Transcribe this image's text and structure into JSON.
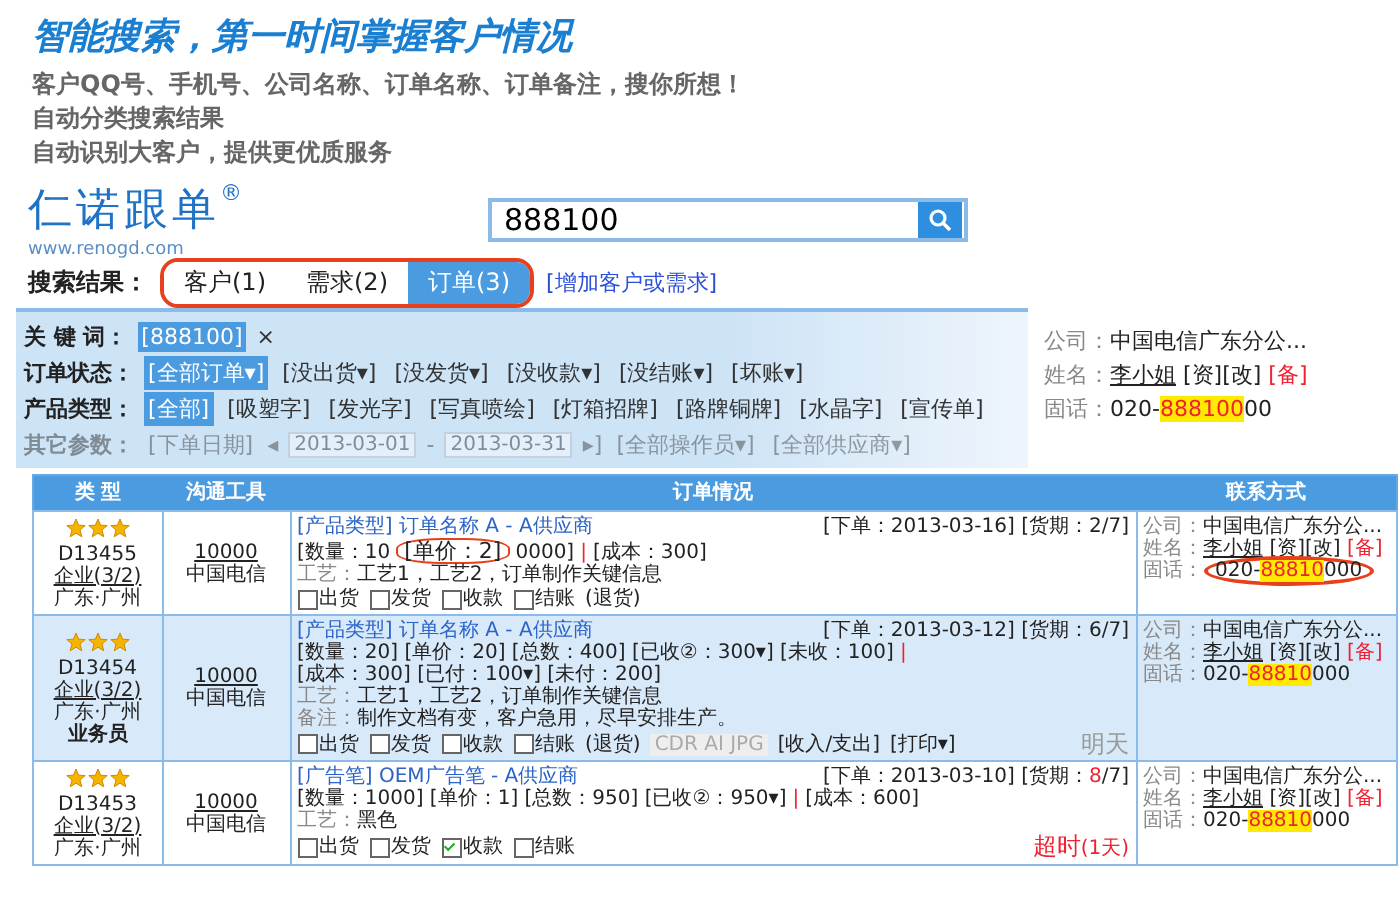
{
  "headline": "智能搜索，第一时间掌握客户情况",
  "features": [
    "客户QQ号、手机号、公司名称、订单名称、订单备注，搜你所想！",
    "自动分类搜索结果",
    "自动识别大客户，提供更优质服务"
  ],
  "app": {
    "logo": "仁诺跟单",
    "logo_mark": "®",
    "logo_url": "www.renogd.com",
    "search": {
      "value": "888100"
    },
    "results_label": "搜索结果：",
    "result_tabs": [
      {
        "label": "客户(1)",
        "selected": false
      },
      {
        "label": "需求(2)",
        "selected": false
      },
      {
        "label": "订单(3)",
        "selected": true
      }
    ],
    "add_link": "[增加客户或需求]",
    "filters": [
      {
        "label": "关 键 词：",
        "faded": false,
        "items": [
          {
            "text": "[888100]",
            "kind": "chip",
            "selected": true
          },
          {
            "text": "×",
            "kind": "close"
          }
        ]
      },
      {
        "label": "订单状态：",
        "faded": false,
        "items": [
          {
            "text": "[全部订单▾]",
            "kind": "chip",
            "selected": true
          },
          {
            "text": "[没出货▾]",
            "kind": "chip",
            "selected": false
          },
          {
            "text": "[没发货▾]",
            "kind": "chip",
            "selected": false
          },
          {
            "text": "[没收款▾]",
            "kind": "chip",
            "selected": false
          },
          {
            "text": "[没结账▾]",
            "kind": "chip",
            "selected": false
          },
          {
            "text": "[坏账▾]",
            "kind": "chip",
            "selected": false
          }
        ]
      },
      {
        "label": "产品类型：",
        "faded": false,
        "items": [
          {
            "text": "[全部]",
            "kind": "chip",
            "selected": true
          },
          {
            "text": "[吸塑字]",
            "kind": "chip",
            "selected": false
          },
          {
            "text": "[发光字]",
            "kind": "chip",
            "selected": false
          },
          {
            "text": "[写真喷绘]",
            "kind": "chip",
            "selected": false
          },
          {
            "text": "[灯箱招牌]",
            "kind": "chip",
            "selected": false
          },
          {
            "text": "[路牌铜牌]",
            "kind": "chip",
            "selected": false
          },
          {
            "text": "[水晶字]",
            "kind": "chip",
            "selected": false
          },
          {
            "text": "[宣传单]",
            "kind": "chip",
            "selected": false
          }
        ]
      },
      {
        "label": "其它参数：",
        "faded": true,
        "items": [
          {
            "text": "[下单日期]",
            "kind": "chip",
            "selected": false
          },
          {
            "text": "◂",
            "kind": "close"
          },
          {
            "text": "2013-03-01",
            "kind": "field"
          },
          {
            "text": "-",
            "kind": "text"
          },
          {
            "text": "2013-03-31",
            "kind": "field"
          },
          {
            "text": "▸]",
            "kind": "close"
          },
          {
            "text": "[全部操作员▾]",
            "kind": "chip",
            "selected": false
          },
          {
            "text": "[全部供应商▾]",
            "kind": "chip",
            "selected": false
          }
        ]
      }
    ],
    "contact_card": {
      "company_label": "公司：",
      "company": "中国电信广东分公...",
      "name_label": "姓名：",
      "name": "李小姐",
      "actions": "[资][改]",
      "note": "[备]",
      "phone_label": "固话：",
      "phone_prefix": "020-",
      "phone_match": "888100",
      "phone_rest": "00"
    },
    "table": {
      "columns": [
        "类 型",
        "沟通工具",
        "订单情况",
        "联系方式"
      ],
      "rows": [
        {
          "stars": 3,
          "code": "D13455",
          "level": "企业(3/2)",
          "region": "广东·广州",
          "tool_id": "10000",
          "tool_name": "中国电信",
          "title": "[产品类型] 订单名称 A - A供应商",
          "date": "[下单：2013-03-16]",
          "due_prefix": "[货期：",
          "due_days": "2",
          "due_suffix": "/7]",
          "due_overdue": false,
          "figures": [
            {
              "text": "[数量：10",
              "kind": "text"
            },
            {
              "text": "[单价：2]",
              "kind": "callout"
            },
            {
              "text": "0000]",
              "kind": "text"
            },
            {
              "text": "|",
              "kind": "sep"
            },
            {
              "text": "[成本：300]",
              "kind": "text"
            }
          ],
          "notes": [
            {
              "label": "工艺：",
              "text": "工艺1，工艺2，订单制作关键信息"
            }
          ],
          "checks": [
            {
              "label": "出货",
              "checked": false
            },
            {
              "label": "发货",
              "checked": false
            },
            {
              "label": "收款",
              "checked": false
            },
            {
              "label": "结账",
              "checked": false
            }
          ],
          "extras": [
            {
              "text": "(退货)",
              "kind": "link"
            }
          ],
          "contact": {
            "company_label": "公司：",
            "company": "中国电信广东分公...",
            "name_label": "姓名：",
            "name": "李小姐",
            "actions": "[资][改]",
            "note": "[备]",
            "phone_label": "固话：",
            "phone_prefix": "020-",
            "phone_match": "88810",
            "phone_rest": "000",
            "circled": true
          }
        },
        {
          "stars": 3,
          "code": "D13454",
          "level": "企业(3/2)",
          "region": "广东·广州",
          "agent": "业务员",
          "tool_id": "10000",
          "tool_name": "中国电信",
          "title": "[产品类型] 订单名称 A - A供应商",
          "date": "[下单：2013-03-12]",
          "due_prefix": "[货期：",
          "due_days": "6",
          "due_suffix": "/7]",
          "due_overdue": false,
          "figures": [
            {
              "text": "[数量：20] [单价：20] [总数：400] [已收②：300▾] [未收：100]",
              "kind": "text"
            },
            {
              "text": "|",
              "kind": "sep"
            },
            {
              "text": "[成本：300] [已付：100▾] [未付：200]",
              "kind": "text"
            }
          ],
          "notes": [
            {
              "label": "工艺：",
              "text": "工艺1，工艺2，订单制作关键信息"
            },
            {
              "label": "备注：",
              "text": "制作文档有变，客户急用，尽早安排生产。"
            }
          ],
          "checks": [
            {
              "label": "出货",
              "checked": false
            },
            {
              "label": "发货",
              "checked": false
            },
            {
              "label": "收款",
              "checked": false
            },
            {
              "label": "结账",
              "checked": false
            }
          ],
          "extras": [
            {
              "text": "(退货)",
              "kind": "link"
            },
            {
              "text": "CDR AI JPG",
              "kind": "faded"
            },
            {
              "text": "[收入/支出]",
              "kind": "link"
            },
            {
              "text": "[打印▾]",
              "kind": "link"
            }
          ],
          "status": {
            "text": "明天",
            "kind": "soon"
          },
          "contact": {
            "company_label": "公司：",
            "company": "中国电信广东分公...",
            "name_label": "姓名：",
            "name": "李小姐",
            "actions": "[资][改]",
            "note": "[备]",
            "phone_label": "固话：",
            "phone_prefix": "020-",
            "phone_match": "88810",
            "phone_rest": "000",
            "circled": false
          }
        },
        {
          "stars": 3,
          "code": "D13453",
          "level": "企业(3/2)",
          "region": "广东·广州",
          "tool_id": "10000",
          "tool_name": "中国电信",
          "title": "[广告笔] OEM广告笔 - A供应商",
          "date": "[下单：2013-03-10]",
          "due_prefix": "[货期：",
          "due_days": "8",
          "due_suffix": "/7]",
          "due_overdue": true,
          "figures": [
            {
              "text": "[数量：1000] [单价：1] [总数：950] [已收②：950▾]",
              "kind": "text"
            },
            {
              "text": "|",
              "kind": "sep"
            },
            {
              "text": "[成本：600]",
              "kind": "text"
            }
          ],
          "notes": [
            {
              "label": "工艺：",
              "text": "黑色"
            }
          ],
          "checks": [
            {
              "label": "出货",
              "checked": false
            },
            {
              "label": "发货",
              "checked": false
            },
            {
              "label": "收款",
              "checked": true
            },
            {
              "label": "结账",
              "checked": false
            }
          ],
          "status": {
            "text": "超时",
            "kind": "late",
            "detail": "(1天)"
          },
          "contact": {
            "company_label": "公司：",
            "company": "中国电信广东分公...",
            "name_label": "姓名：",
            "name": "李小姐",
            "actions": "[资][改]",
            "note": "[备]",
            "phone_label": "固话：",
            "phone_prefix": "020-",
            "phone_match": "88810",
            "phone_rest": "000",
            "circled": false
          }
        }
      ]
    }
  }
}
